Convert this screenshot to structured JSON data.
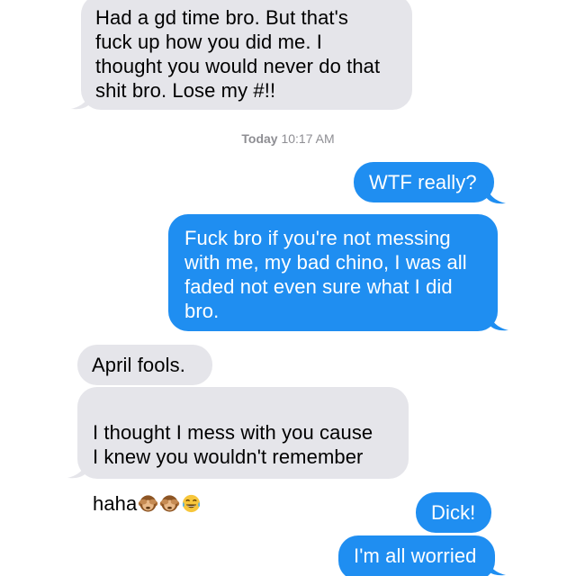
{
  "messages": [
    {
      "side": "in",
      "text": "Had a gd time bro. But that's\nfuck up how you did me. I\nthought you would never do that\nshit bro. Lose my #!!"
    },
    {
      "side": "out",
      "text": "WTF really?"
    },
    {
      "side": "out",
      "text": "Fuck bro if you're not messing\nwith me, my bad chino, I was all\nfaded not even sure what I did\nbro."
    },
    {
      "side": "in",
      "text": "April fools."
    },
    {
      "side": "in",
      "text": "I thought I mess with you cause\nI knew you wouldn't remember\nhaha",
      "emojis": [
        "see-no-evil-monkey",
        "see-no-evil-monkey",
        "tears-of-joy-face"
      ]
    },
    {
      "side": "out",
      "text": "Dick!"
    },
    {
      "side": "out",
      "text": "I'm all worried"
    }
  ],
  "timestamp": {
    "day": "Today",
    "time": "10:17 AM"
  },
  "colors": {
    "incoming_bubble": "#e5e5ea",
    "outgoing_bubble": "#1f8ef1",
    "timestamp_text": "#8e8e93"
  }
}
